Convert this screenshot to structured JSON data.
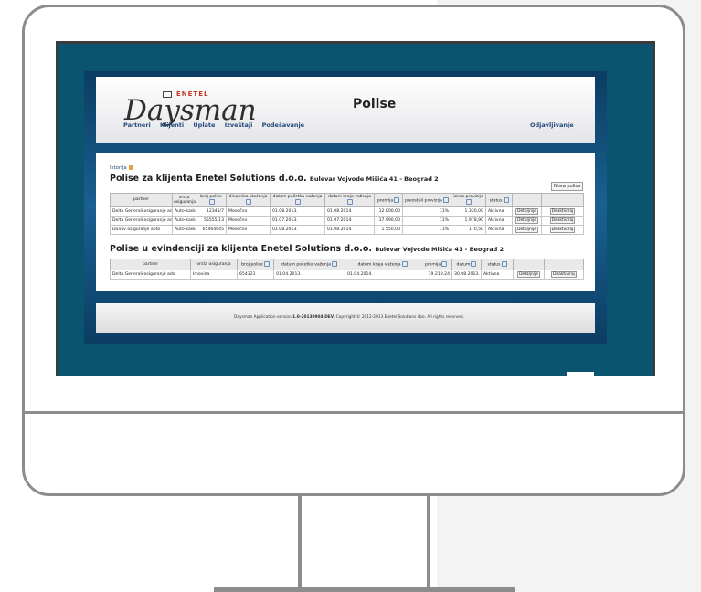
{
  "header": {
    "brand_small": "ENETEL",
    "brand_main": "Daysman",
    "title": "Polise",
    "nav": [
      "Partneri",
      "Klijenti",
      "Uplate",
      "Izveštaji",
      "Podešavanje"
    ],
    "logout": "Odjavljivanje"
  },
  "breadcrumb": "Istorija",
  "section1": {
    "title": "Polise za klijenta Enetel Solutions d.o.o.",
    "address": "Bulevar Vojvode Mišića 41 - Beograd 2",
    "new_button": "Nova polisa",
    "columns": [
      "partner",
      "vrsta osiguranja",
      "broj polise",
      "dinamika plaćanja",
      "datum početka važenja",
      "datum kraja važenja",
      "premija",
      "preostali provizija",
      "iznos provizije",
      "status",
      "",
      ""
    ],
    "rows": [
      [
        "Delta Generali osiguranje ado",
        "Auto-kasko",
        "12345/7",
        "Mesečno",
        "01.08.2013.",
        "01.08.2014.",
        "12.000,00",
        "11%",
        "1.320,00",
        "Aktivna",
        "Detaljnije",
        "Deaktiviraj"
      ],
      [
        "Delta Generali osiguranje ado",
        "Auto-kasko",
        "55555/13",
        "Mesečno",
        "01.07.2013.",
        "01.07.2014.",
        "17.990,00",
        "11%",
        "1.978,90",
        "Aktivna",
        "Detaljnije",
        "Deaktiviraj"
      ],
      [
        "Dunav osiguranje auto",
        "Auto-kasko",
        "65464645",
        "Mesečno",
        "01.08.2013.",
        "01.08.2014.",
        "1.550,00",
        "11%",
        "170,50",
        "Aktivna",
        "Detaljnije",
        "Deaktiviraj"
      ]
    ]
  },
  "section2": {
    "title": "Polise u evindenciji za klijenta Enetel Solutions d.o.o.",
    "address": "Bulevar Vojvode Mišića 41 - Beograd 2",
    "columns": [
      "partner",
      "vrsta osiguranja",
      "broj polise",
      "datum početka važenja",
      "datum kraja važenja",
      "premija",
      "datum",
      "status",
      "",
      ""
    ],
    "rows": [
      [
        "Delta Generali osiguranje ado",
        "Imovina",
        "654321",
        "01.04.2013.",
        "01.04.2014.",
        "19.219,24",
        "30.08.2013.",
        "Aktivna",
        "Detaljnije",
        "Deaktiviraj"
      ]
    ]
  },
  "footer": {
    "prefix": "Daysman Application version",
    "version": "1.0-20130904-DEV",
    "suffix": ". Copyright © 2012-2013 Enetel Solutions doo. All rights reserved."
  }
}
